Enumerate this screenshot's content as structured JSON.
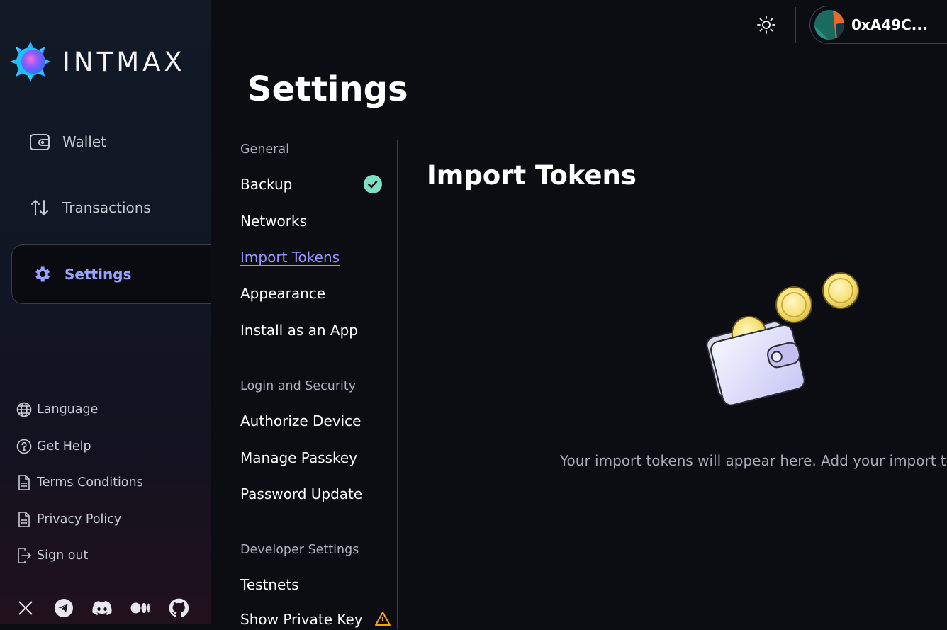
{
  "brand": {
    "name": "INTMAX"
  },
  "sidebar": {
    "nav": [
      {
        "label": "Wallet",
        "icon": "wallet-icon"
      },
      {
        "label": "Transactions",
        "icon": "arrows-up-down-icon"
      },
      {
        "label": "Settings",
        "icon": "gear-icon",
        "active": true
      }
    ],
    "footer": [
      {
        "label": "Language",
        "icon": "globe-icon"
      },
      {
        "label": "Get Help",
        "icon": "help-circle-icon"
      },
      {
        "label": "Terms Conditions",
        "icon": "document-icon"
      },
      {
        "label": "Privacy Policy",
        "icon": "document-icon"
      },
      {
        "label": "Sign out",
        "icon": "sign-out-icon"
      }
    ],
    "socials": [
      "x-icon",
      "telegram-icon",
      "discord-icon",
      "medium-icon",
      "github-icon"
    ]
  },
  "topbar": {
    "theme_icon": "sun-icon",
    "account_label": "0xA49C..."
  },
  "page": {
    "title": "Settings"
  },
  "settings_menu": {
    "general_heading": "General",
    "general": [
      "Backup",
      "Networks",
      "Import Tokens",
      "Appearance",
      "Install as an App"
    ],
    "security_heading": "Login and Security",
    "security": [
      "Authorize Device",
      "Manage Passkey",
      "Password Update"
    ],
    "developer_heading": "Developer Settings",
    "developer": [
      "Testnets",
      "Show Private Key"
    ],
    "current": "Import Tokens"
  },
  "content": {
    "title": "Import Tokens",
    "empty_message": "Your import tokens will appear here. Add your import tok"
  },
  "colors": {
    "accent": "#9b93ff",
    "success": "#7ee0c2",
    "warning": "#f2a31b"
  }
}
